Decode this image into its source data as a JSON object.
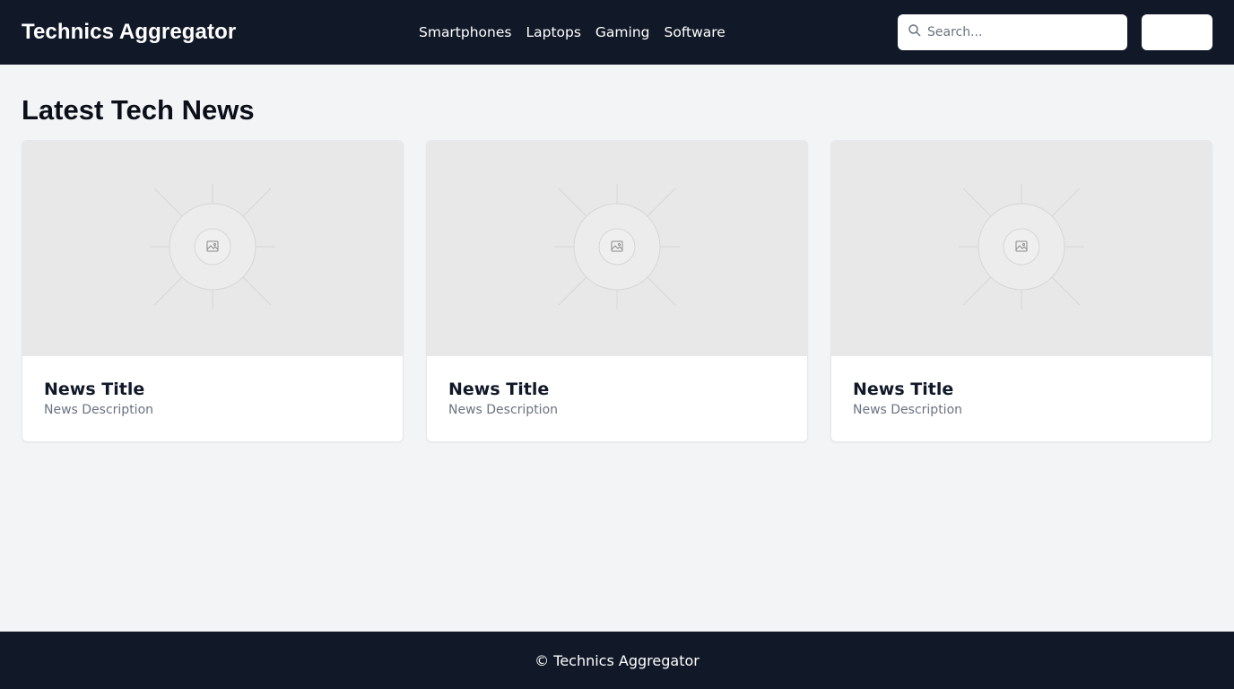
{
  "header": {
    "brand": "Technics Aggregator",
    "nav": [
      "Smartphones",
      "Laptops",
      "Gaming",
      "Software"
    ],
    "search": {
      "placeholder": "Search...",
      "value": ""
    },
    "action_button_label": ""
  },
  "main": {
    "heading": "Latest Tech News",
    "cards": [
      {
        "title": "News Title",
        "description": "News Description",
        "image_icon": "image-placeholder-icon"
      },
      {
        "title": "News Title",
        "description": "News Description",
        "image_icon": "image-placeholder-icon"
      },
      {
        "title": "News Title",
        "description": "News Description",
        "image_icon": "image-placeholder-icon"
      }
    ]
  },
  "footer": {
    "text": "© Technics Aggregator"
  },
  "colors": {
    "header_bg": "#111827",
    "page_bg": "#f3f4f6",
    "card_bg": "#ffffff",
    "image_bg": "#e8e8e8",
    "muted_text": "#6b7280"
  }
}
